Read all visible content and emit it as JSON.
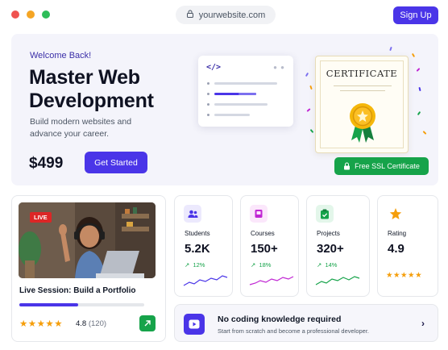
{
  "window": {
    "controls": [
      {
        "name": "close",
        "color": "#ef5350"
      },
      {
        "name": "minimize",
        "color": "#f5a524"
      },
      {
        "name": "maximize",
        "color": "#2ebd59"
      }
    ],
    "url": "yourwebsite.com",
    "signup_label": "Sign Up"
  },
  "hero": {
    "welcome": "Welcome Back!",
    "headline_1": "Master Web",
    "headline_2": "Development",
    "subtitle_1": "Build modern websites and",
    "subtitle_2": "advance your career.",
    "price": "$499",
    "cta_label": "Get Started",
    "code_icon": "</>",
    "certificate_title": "CERTIFICATE",
    "ssl_label": "Free SSL Certificate"
  },
  "live_session": {
    "badge": "LIVE",
    "title": "Live Session: Build a Portfolio",
    "progress": 0.47,
    "stars": "★★★★★",
    "rating": "4.8",
    "rating_count": "(120)"
  },
  "stats": [
    {
      "label": "Students",
      "value": "5.2K",
      "delta": "12%",
      "icon": "users-icon",
      "color": "#4a35e8",
      "bg": "#ece9fd"
    },
    {
      "label": "Courses",
      "value": "150+",
      "delta": "18%",
      "icon": "book-icon",
      "color": "#c026d3",
      "bg": "#fbe7fb"
    },
    {
      "label": "Projects",
      "value": "320+",
      "delta": "14%",
      "icon": "clipboard-check-icon",
      "color": "#16a34a",
      "bg": "#e3f6ea"
    },
    {
      "label": "Rating",
      "value": "4.9",
      "stars": "★★★★★",
      "icon": "star-icon",
      "color": "#f59e0b"
    }
  ],
  "promo": {
    "title": "No coding knowledge required",
    "subtitle": "Start from scratch and become a professional developer."
  },
  "colors": {
    "primary": "#4a35e8",
    "success": "#16a34a",
    "star": "#f59e0b",
    "live": "#dc2626"
  }
}
